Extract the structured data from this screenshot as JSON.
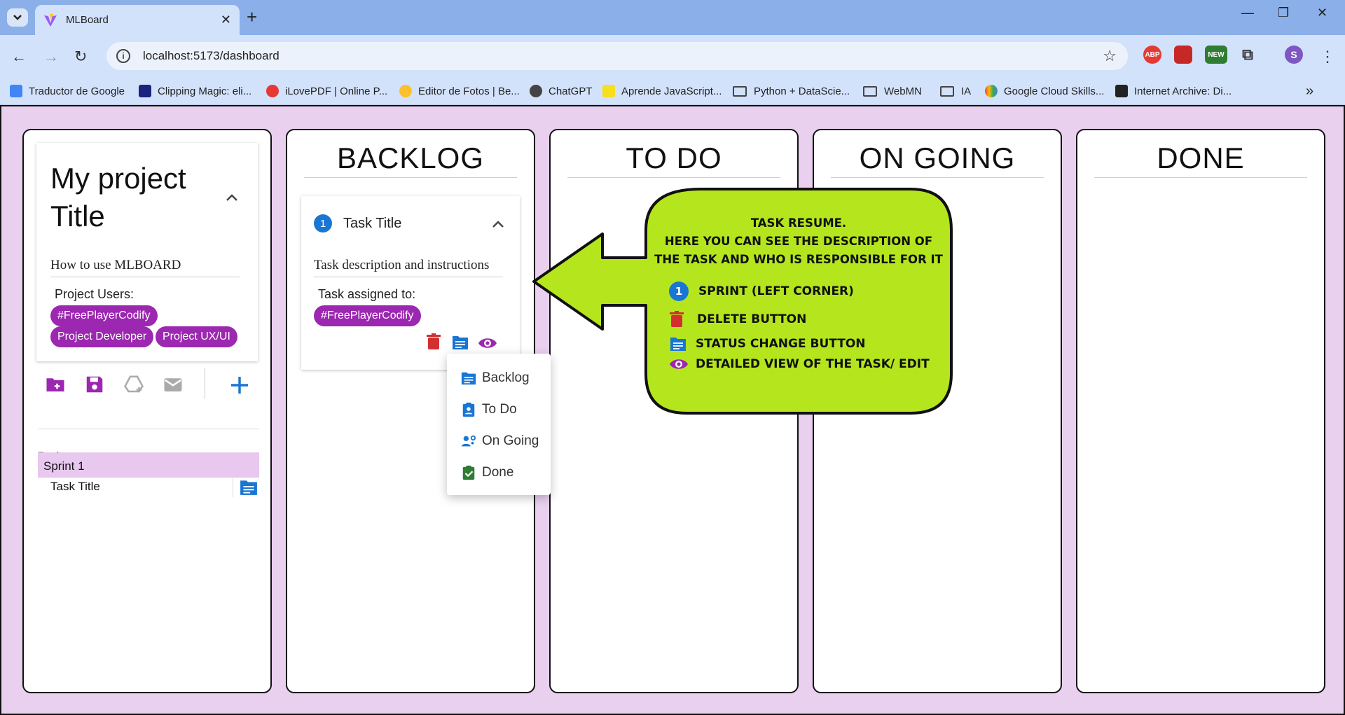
{
  "browser": {
    "tab_title": "MLBoard",
    "url": "localhost:5173/dashboard",
    "bookmarks": [
      "Traductor de Google",
      "Clipping Magic: eli...",
      "iLovePDF | Online P...",
      "Editor de Fotos | Be...",
      "ChatGPT",
      "Aprende JavaScript...",
      "Python + DataScie...",
      "WebMN",
      "IA",
      "Google Cloud Skills...",
      "Internet Archive: Di..."
    ],
    "ext_abp": "ABP",
    "ext_new": "NEW",
    "profile_initial": "S"
  },
  "sidebar": {
    "project_title": "My project Title",
    "description": "How to use MLBOARD",
    "users_label": "Project Users:",
    "users": [
      "#FreePlayerCodify",
      "Project Developer",
      "Project UX/UI"
    ],
    "tree_label": "Project tree:",
    "tree": [
      {
        "sprint": "Sprint 1",
        "tasks": [
          "Task Title"
        ]
      }
    ]
  },
  "columns": [
    "BACKLOG",
    "TO DO",
    "ON GOING",
    "DONE"
  ],
  "task_card": {
    "sprint_number": "1",
    "title": "Task Title",
    "description": "Task description and instructions",
    "assigned_label": "Task assigned to:",
    "assignee": "#FreePlayerCodify"
  },
  "status_menu": {
    "items": [
      "Backlog",
      "To Do",
      "On Going",
      "Done"
    ]
  },
  "callout": {
    "heading": [
      "TASK RESUME.",
      "HERE YOU CAN SEE THE DESCRIPTION OF",
      "THE TASK AND WHO IS RESPONSIBLE FOR IT"
    ],
    "legend": [
      {
        "icon": "sprint-badge-icon",
        "label": "SPRINT (LEFT CORNER)",
        "badge": "1"
      },
      {
        "icon": "trash-icon",
        "label": "DELETE BUTTON"
      },
      {
        "icon": "list-folder-icon",
        "label": "STATUS CHANGE BUTTON"
      },
      {
        "icon": "eye-icon",
        "label": "DETAILED VIEW OF THE TASK/ EDIT"
      }
    ]
  },
  "colors": {
    "purple": "#9c27b0",
    "blue": "#1976d2",
    "red": "#d32f2f",
    "callout_green": "#b5e61d",
    "board_bg": "#e8d0ee"
  }
}
